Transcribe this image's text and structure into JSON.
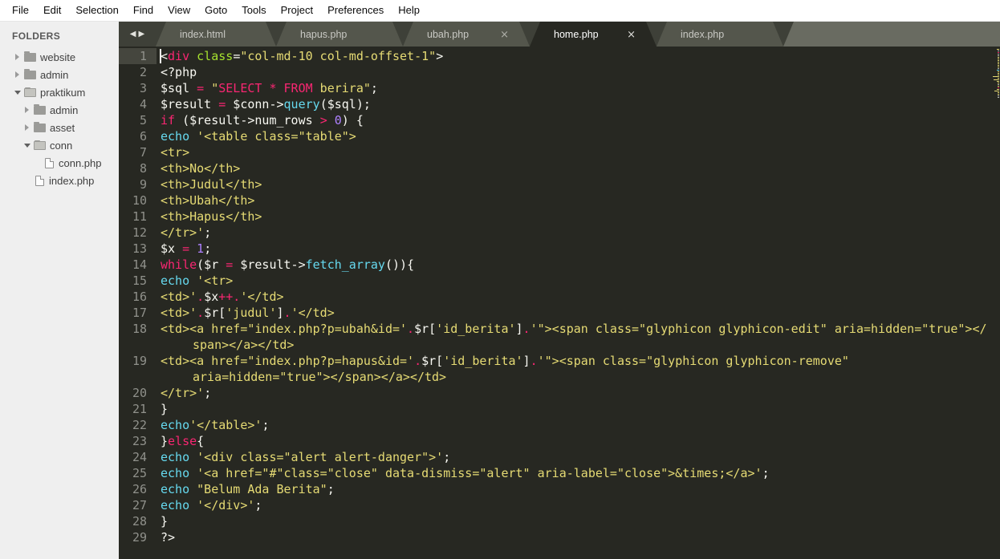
{
  "menu": {
    "items": [
      "File",
      "Edit",
      "Selection",
      "Find",
      "View",
      "Goto",
      "Tools",
      "Project",
      "Preferences",
      "Help"
    ]
  },
  "sidebar": {
    "header": "FOLDERS",
    "items": [
      {
        "label": "website",
        "type": "folder",
        "state": "collapsed",
        "depth": 0
      },
      {
        "label": "admin",
        "type": "folder",
        "state": "collapsed",
        "depth": 0
      },
      {
        "label": "praktikum",
        "type": "folder",
        "state": "expanded",
        "depth": 0
      },
      {
        "label": "admin",
        "type": "folder",
        "state": "collapsed",
        "depth": 1
      },
      {
        "label": "asset",
        "type": "folder",
        "state": "collapsed",
        "depth": 1
      },
      {
        "label": "conn",
        "type": "folder",
        "state": "expanded",
        "depth": 1
      },
      {
        "label": "conn.php",
        "type": "file",
        "depth": 2
      },
      {
        "label": "index.php",
        "type": "file",
        "depth": 1
      }
    ]
  },
  "tabbar": {
    "scroll_left_icon": "◀",
    "scroll_right_icon": "▶",
    "tabs": [
      {
        "label": "index.html",
        "indicator": "modified",
        "active": false
      },
      {
        "label": "hapus.php",
        "indicator": "modified",
        "active": false
      },
      {
        "label": "ubah.php",
        "indicator": "close",
        "active": false
      },
      {
        "label": "home.php",
        "indicator": "close",
        "active": true
      },
      {
        "label": "index.php",
        "indicator": "modified",
        "active": false
      }
    ]
  },
  "colors": {
    "editor_bg": "#272822",
    "pink": "#f92672",
    "yellow": "#e6db74",
    "cyan": "#66d9ef",
    "green": "#a6e22e",
    "purple": "#ae81ff",
    "white": "#f8f8f2"
  },
  "editor": {
    "rows": [
      {
        "num": "1",
        "cursor": true,
        "segs": [
          [
            "w",
            "<"
          ],
          [
            "p",
            "div"
          ],
          [
            "w",
            " "
          ],
          [
            "g",
            "class"
          ],
          [
            "w",
            "="
          ],
          [
            "y",
            "\"col-md-10 col-md-offset-1\""
          ],
          [
            "w",
            ">"
          ]
        ]
      },
      {
        "num": "2",
        "segs": [
          [
            "w",
            "<?php"
          ]
        ]
      },
      {
        "num": "3",
        "segs": [
          [
            "w",
            "$sql "
          ],
          [
            "p",
            "="
          ],
          [
            "w",
            " "
          ],
          [
            "y",
            "\""
          ],
          [
            "p",
            "SELECT * FROM"
          ],
          [
            "y",
            " berira\""
          ],
          [
            "w",
            ";"
          ]
        ]
      },
      {
        "num": "4",
        "segs": [
          [
            "w",
            "$result "
          ],
          [
            "p",
            "="
          ],
          [
            "w",
            " $conn->"
          ],
          [
            "c",
            "query"
          ],
          [
            "w",
            "($sql);"
          ]
        ]
      },
      {
        "num": "5",
        "segs": [
          [
            "p",
            "if"
          ],
          [
            "w",
            " ($result->num_rows "
          ],
          [
            "p",
            ">"
          ],
          [
            "w",
            " "
          ],
          [
            "v",
            "0"
          ],
          [
            "w",
            ") {"
          ]
        ]
      },
      {
        "num": "6",
        "segs": [
          [
            "c",
            "echo"
          ],
          [
            "w",
            " "
          ],
          [
            "y",
            "'<table class=\"table\">"
          ]
        ]
      },
      {
        "num": "7",
        "segs": [
          [
            "y",
            "<tr>"
          ]
        ]
      },
      {
        "num": "8",
        "segs": [
          [
            "y",
            "<th>No</th>"
          ]
        ]
      },
      {
        "num": "9",
        "segs": [
          [
            "y",
            "<th>Judul</th>"
          ]
        ]
      },
      {
        "num": "10",
        "segs": [
          [
            "y",
            "<th>Ubah</th>"
          ]
        ]
      },
      {
        "num": "11",
        "segs": [
          [
            "y",
            "<th>Hapus</th>"
          ]
        ]
      },
      {
        "num": "12",
        "segs": [
          [
            "y",
            "</tr>'"
          ],
          [
            "w",
            ";"
          ]
        ]
      },
      {
        "num": "13",
        "segs": [
          [
            "w",
            "$x "
          ],
          [
            "p",
            "="
          ],
          [
            "w",
            " "
          ],
          [
            "v",
            "1"
          ],
          [
            "w",
            ";"
          ]
        ]
      },
      {
        "num": "14",
        "segs": [
          [
            "p",
            "while"
          ],
          [
            "w",
            "($r "
          ],
          [
            "p",
            "="
          ],
          [
            "w",
            " $result->"
          ],
          [
            "c",
            "fetch_array"
          ],
          [
            "w",
            "()){"
          ]
        ]
      },
      {
        "num": "15",
        "segs": [
          [
            "c",
            "echo"
          ],
          [
            "w",
            " "
          ],
          [
            "y",
            "'<tr>"
          ]
        ]
      },
      {
        "num": "16",
        "segs": [
          [
            "y",
            "<td>'"
          ],
          [
            "p",
            "."
          ],
          [
            "w",
            "$x"
          ],
          [
            "p",
            "++."
          ],
          [
            "y",
            "'</td>"
          ]
        ]
      },
      {
        "num": "17",
        "segs": [
          [
            "y",
            "<td>'"
          ],
          [
            "p",
            "."
          ],
          [
            "w",
            "$r["
          ],
          [
            "y",
            "'judul'"
          ],
          [
            "w",
            "]"
          ],
          [
            "p",
            "."
          ],
          [
            "y",
            "'</td>"
          ]
        ]
      },
      {
        "num": "18",
        "segs": [
          [
            "y",
            "<td><a href=\"index.php?p=ubah&id='"
          ],
          [
            "p",
            "."
          ],
          [
            "w",
            "$r["
          ],
          [
            "y",
            "'id_berita'"
          ],
          [
            "w",
            "]"
          ],
          [
            "p",
            "."
          ],
          [
            "y",
            "'\"><span class=\"glyphicon glyphicon-edit\" aria=hidden=\"true\"></"
          ]
        ]
      },
      {
        "num": "",
        "wrap": true,
        "segs": [
          [
            "y",
            "span></a></td>"
          ]
        ]
      },
      {
        "num": "19",
        "segs": [
          [
            "y",
            "<td><a href=\"index.php?p=hapus&id='"
          ],
          [
            "p",
            "."
          ],
          [
            "w",
            "$r["
          ],
          [
            "y",
            "'id_berita'"
          ],
          [
            "w",
            "]"
          ],
          [
            "p",
            "."
          ],
          [
            "y",
            "'\"><span class=\"glyphicon glyphicon-remove\""
          ]
        ]
      },
      {
        "num": "",
        "wrap": true,
        "segs": [
          [
            "y",
            "aria=hidden=\"true\"></span></a></td>"
          ]
        ]
      },
      {
        "num": "20",
        "segs": [
          [
            "y",
            "</tr>'"
          ],
          [
            "w",
            ";"
          ]
        ]
      },
      {
        "num": "21",
        "segs": [
          [
            "w",
            "}"
          ]
        ]
      },
      {
        "num": "22",
        "segs": [
          [
            "c",
            "echo"
          ],
          [
            "y",
            "'</table>'"
          ],
          [
            "w",
            ";"
          ]
        ]
      },
      {
        "num": "23",
        "segs": [
          [
            "w",
            "}"
          ],
          [
            "p",
            "else"
          ],
          [
            "w",
            "{"
          ]
        ]
      },
      {
        "num": "24",
        "segs": [
          [
            "c",
            "echo"
          ],
          [
            "w",
            " "
          ],
          [
            "y",
            "'<div class=\"alert alert-danger\">'"
          ],
          [
            "w",
            ";"
          ]
        ]
      },
      {
        "num": "25",
        "segs": [
          [
            "c",
            "echo"
          ],
          [
            "w",
            " "
          ],
          [
            "y",
            "'<a href=\"#\"class=\"close\" data-dismiss=\"alert\" aria-label=\"close\">&times;</a>'"
          ],
          [
            "w",
            ";"
          ]
        ]
      },
      {
        "num": "26",
        "segs": [
          [
            "c",
            "echo"
          ],
          [
            "w",
            " "
          ],
          [
            "y",
            "\"Belum Ada Berita\""
          ],
          [
            "w",
            ";"
          ]
        ]
      },
      {
        "num": "27",
        "segs": [
          [
            "c",
            "echo"
          ],
          [
            "w",
            " "
          ],
          [
            "y",
            "'</div>'"
          ],
          [
            "w",
            ";"
          ]
        ]
      },
      {
        "num": "28",
        "segs": [
          [
            "w",
            "}"
          ]
        ]
      },
      {
        "num": "29",
        "segs": [
          [
            "w",
            "?>"
          ]
        ]
      }
    ]
  }
}
